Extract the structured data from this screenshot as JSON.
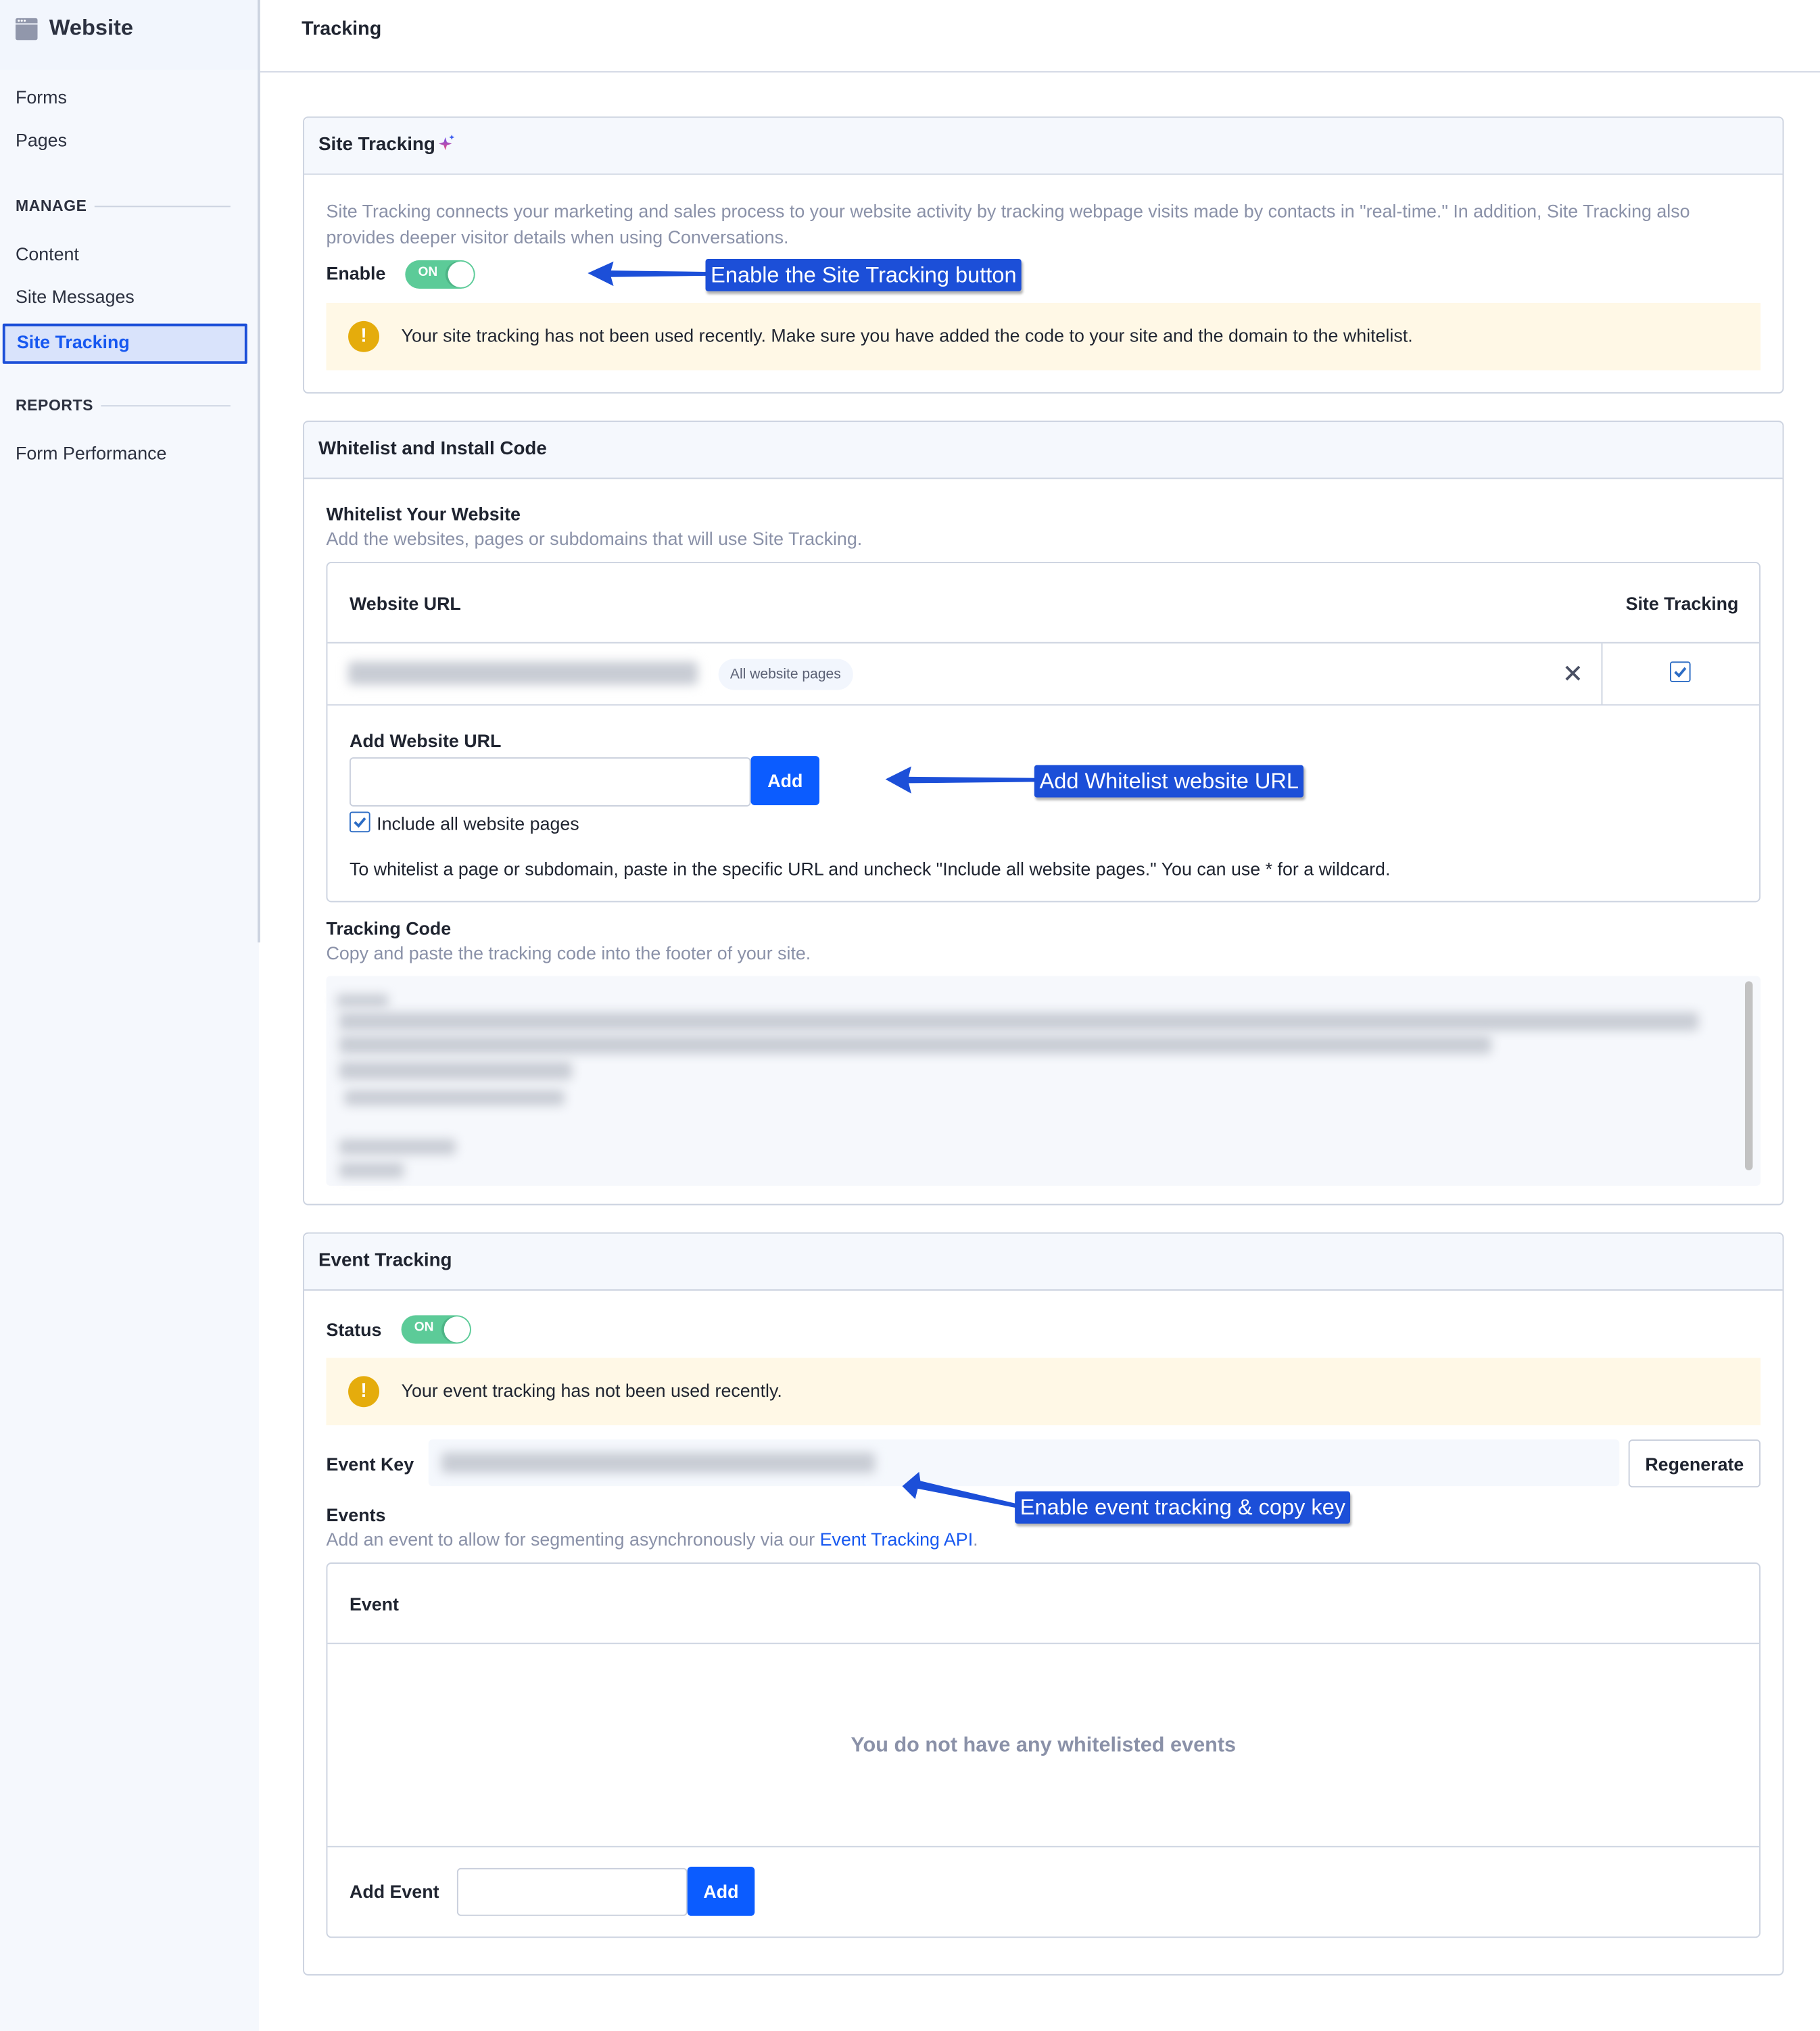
{
  "sidebar": {
    "app_title": "Website",
    "app_icon": "browser-window-icon",
    "items_top": [
      {
        "label": "Forms"
      },
      {
        "label": "Pages"
      }
    ],
    "sections": [
      {
        "title": "MANAGE",
        "items": [
          {
            "label": "Content"
          },
          {
            "label": "Site Messages"
          },
          {
            "label": "Site Tracking",
            "active": true
          }
        ]
      },
      {
        "title": "REPORTS",
        "items": [
          {
            "label": "Form Performance"
          }
        ]
      }
    ]
  },
  "header": {
    "title": "Tracking"
  },
  "site_tracking": {
    "title": "Site Tracking",
    "title_icon": "sparkle-icon",
    "description": "Site Tracking connects your marketing and sales process to your website activity by tracking webpage visits made by contacts in \"real-time.\" In addition, Site Tracking also provides deeper visitor details when using Conversations.",
    "enable_label": "Enable",
    "toggle_state": "ON",
    "alert": "Your site tracking has not been used recently. Make sure you have added the code to your site and the domain to the whitelist.",
    "callout": "Enable the Site Tracking button"
  },
  "whitelist": {
    "title": "Whitelist and Install Code",
    "subtitle": "Whitelist Your Website",
    "subtitle_desc": "Add the websites, pages or subdomains that will use Site Tracking.",
    "table": {
      "columns": [
        "Website URL",
        "Site Tracking"
      ],
      "rows": [
        {
          "url": "[blurred]",
          "badge": "All website pages",
          "site_tracking_checked": true
        }
      ]
    },
    "add_label": "Add Website URL",
    "add_input_value": "",
    "add_button": "Add",
    "include_all_label": "Include all website pages",
    "include_all_checked": true,
    "hint": "To whitelist a page or subdomain, paste in the specific URL and uncheck \"Include all website pages.\" You can use * for a wildcard.",
    "callout": "Add Whitelist website URL",
    "tracking_code_title": "Tracking Code",
    "tracking_code_desc": "Copy and paste the tracking code into the footer of your site.",
    "tracking_code": "[blurred]"
  },
  "event_tracking": {
    "title": "Event Tracking",
    "status_label": "Status",
    "toggle_state": "ON",
    "alert": "Your event tracking has not been used recently.",
    "event_key_label": "Event Key",
    "event_key_value": "[blurred]",
    "regenerate_button": "Regenerate",
    "callout": "Enable event tracking & copy key",
    "events_title": "Events",
    "events_desc_prefix": "Add an event to allow for segmenting asynchronously via our ",
    "events_desc_link": "Event Tracking API",
    "events_desc_suffix": ".",
    "table_header": "Event",
    "empty_message": "You do not have any whitelisted events",
    "add_event_label": "Add Event",
    "add_event_value": "",
    "add_button": "Add"
  },
  "colors": {
    "accent": "#0b5cff",
    "annotation": "#1c4fd8",
    "toggle_on": "#5ccb98",
    "warning": "#e5ac0c",
    "warning_bg": "#fff8e6"
  }
}
